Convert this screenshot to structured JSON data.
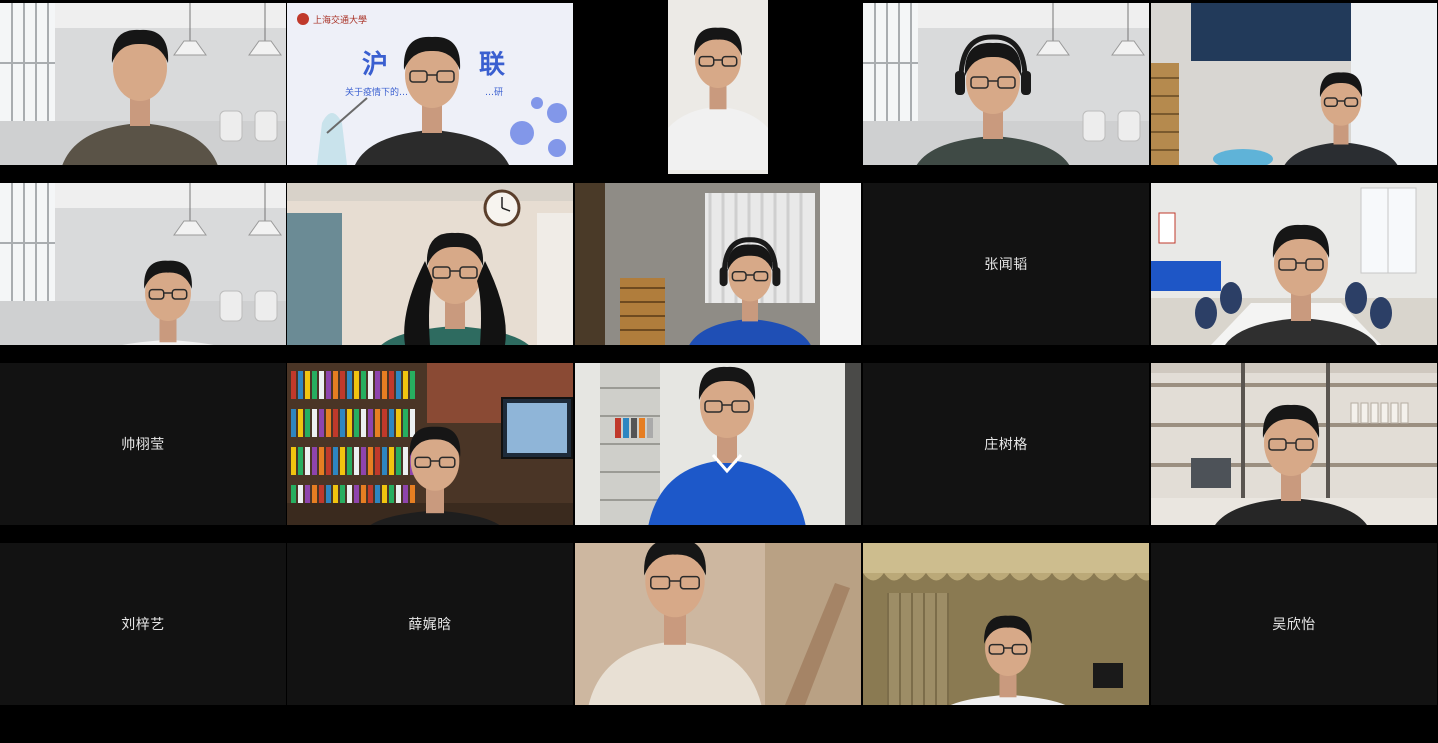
{
  "meeting": {
    "participants": [
      {
        "id": "p1",
        "type": "video",
        "scene": "office-white",
        "shirt": "#5a5347"
      },
      {
        "id": "p2",
        "type": "video",
        "scene": "poster-virtual",
        "shirt": "#2b2b2b",
        "poster_brand": "上海交通大學",
        "poster_title": "沪",
        "poster_title_right": "联",
        "poster_subtitle": "关于疫情下的…",
        "poster_subtitle_right": "…研"
      },
      {
        "id": "p3",
        "type": "video",
        "scene": "dark-narrow",
        "shirt": "#f1f1f1"
      },
      {
        "id": "p4",
        "type": "video",
        "scene": "office-white",
        "shirt": "#3f4a45"
      },
      {
        "id": "p5",
        "type": "video",
        "scene": "dorm-blue",
        "shirt": "#2a2d31"
      },
      {
        "id": "p6",
        "type": "video",
        "scene": "office-white",
        "shirt": "#f2f2f2"
      },
      {
        "id": "p7",
        "type": "video",
        "scene": "room-clock",
        "shirt": "#2e6b60"
      },
      {
        "id": "p8",
        "type": "video",
        "scene": "dorm-curtain",
        "shirt": "#1f4fb5"
      },
      {
        "id": "p9",
        "type": "name",
        "name": "张闻韬"
      },
      {
        "id": "p10",
        "type": "video",
        "scene": "meeting-room",
        "shirt": "#2f2f2f"
      },
      {
        "id": "p11",
        "type": "name",
        "name": "帅栩莹"
      },
      {
        "id": "p12",
        "type": "video",
        "scene": "bookshelf",
        "shirt": "#1e1e1e"
      },
      {
        "id": "p13",
        "type": "video",
        "scene": "dorm-shelf",
        "shirt": "#1d58c9"
      },
      {
        "id": "p14",
        "type": "name",
        "name": "庄树格"
      },
      {
        "id": "p15",
        "type": "video",
        "scene": "library-shelf",
        "shirt": "#262626"
      },
      {
        "id": "p16",
        "type": "name",
        "name": "刘梓艺"
      },
      {
        "id": "p17",
        "type": "name",
        "name": "薛娓晗"
      },
      {
        "id": "p18",
        "type": "video",
        "scene": "warm-closeup",
        "shirt": "#e8e0d4"
      },
      {
        "id": "p19",
        "type": "video",
        "scene": "curtain-gold",
        "shirt": "#f0f0f0"
      },
      {
        "id": "p20",
        "type": "name",
        "name": "吴欣怡"
      }
    ]
  },
  "colors": {
    "background": "#000000",
    "name_tile": "#121212",
    "name_text": "#e6e6e6"
  }
}
